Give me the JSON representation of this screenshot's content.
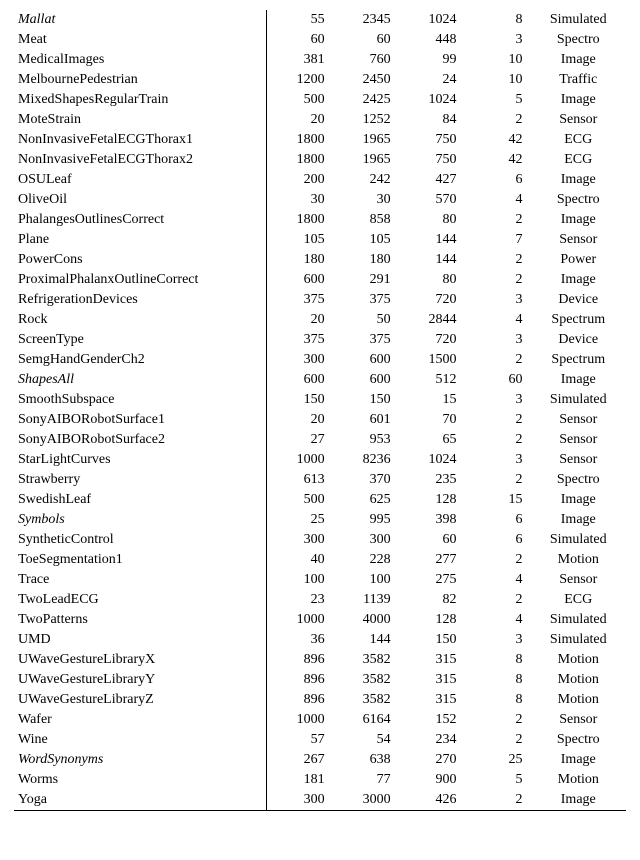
{
  "rows": [
    {
      "name": "Mallat",
      "italic": true,
      "c1": 55,
      "c2": 2345,
      "c3": 1024,
      "c4": 8,
      "cat": "Simulated"
    },
    {
      "name": "Meat",
      "italic": false,
      "c1": 60,
      "c2": 60,
      "c3": 448,
      "c4": 3,
      "cat": "Spectro"
    },
    {
      "name": "MedicalImages",
      "italic": false,
      "c1": 381,
      "c2": 760,
      "c3": 99,
      "c4": 10,
      "cat": "Image"
    },
    {
      "name": "MelbournePedestrian",
      "italic": false,
      "c1": 1200,
      "c2": 2450,
      "c3": 24,
      "c4": 10,
      "cat": "Traffic"
    },
    {
      "name": "MixedShapesRegularTrain",
      "italic": false,
      "c1": 500,
      "c2": 2425,
      "c3": 1024,
      "c4": 5,
      "cat": "Image"
    },
    {
      "name": "MoteStrain",
      "italic": false,
      "c1": 20,
      "c2": 1252,
      "c3": 84,
      "c4": 2,
      "cat": "Sensor"
    },
    {
      "name": "NonInvasiveFetalECGThorax1",
      "italic": false,
      "c1": 1800,
      "c2": 1965,
      "c3": 750,
      "c4": 42,
      "cat": "ECG"
    },
    {
      "name": "NonInvasiveFetalECGThorax2",
      "italic": false,
      "c1": 1800,
      "c2": 1965,
      "c3": 750,
      "c4": 42,
      "cat": "ECG"
    },
    {
      "name": "OSULeaf",
      "italic": false,
      "c1": 200,
      "c2": 242,
      "c3": 427,
      "c4": 6,
      "cat": "Image"
    },
    {
      "name": "OliveOil",
      "italic": false,
      "c1": 30,
      "c2": 30,
      "c3": 570,
      "c4": 4,
      "cat": "Spectro"
    },
    {
      "name": "PhalangesOutlinesCorrect",
      "italic": false,
      "c1": 1800,
      "c2": 858,
      "c3": 80,
      "c4": 2,
      "cat": "Image"
    },
    {
      "name": "Plane",
      "italic": false,
      "c1": 105,
      "c2": 105,
      "c3": 144,
      "c4": 7,
      "cat": "Sensor"
    },
    {
      "name": "PowerCons",
      "italic": false,
      "c1": 180,
      "c2": 180,
      "c3": 144,
      "c4": 2,
      "cat": "Power"
    },
    {
      "name": "ProximalPhalanxOutlineCorrect",
      "italic": false,
      "c1": 600,
      "c2": 291,
      "c3": 80,
      "c4": 2,
      "cat": "Image"
    },
    {
      "name": "RefrigerationDevices",
      "italic": false,
      "c1": 375,
      "c2": 375,
      "c3": 720,
      "c4": 3,
      "cat": "Device"
    },
    {
      "name": "Rock",
      "italic": false,
      "c1": 20,
      "c2": 50,
      "c3": 2844,
      "c4": 4,
      "cat": "Spectrum"
    },
    {
      "name": "ScreenType",
      "italic": false,
      "c1": 375,
      "c2": 375,
      "c3": 720,
      "c4": 3,
      "cat": "Device"
    },
    {
      "name": "SemgHandGenderCh2",
      "italic": false,
      "c1": 300,
      "c2": 600,
      "c3": 1500,
      "c4": 2,
      "cat": "Spectrum"
    },
    {
      "name": "ShapesAll",
      "italic": true,
      "c1": 600,
      "c2": 600,
      "c3": 512,
      "c4": 60,
      "cat": "Image"
    },
    {
      "name": "SmoothSubspace",
      "italic": false,
      "c1": 150,
      "c2": 150,
      "c3": 15,
      "c4": 3,
      "cat": "Simulated"
    },
    {
      "name": "SonyAIBORobotSurface1",
      "italic": false,
      "c1": 20,
      "c2": 601,
      "c3": 70,
      "c4": 2,
      "cat": "Sensor"
    },
    {
      "name": "SonyAIBORobotSurface2",
      "italic": false,
      "c1": 27,
      "c2": 953,
      "c3": 65,
      "c4": 2,
      "cat": "Sensor"
    },
    {
      "name": "StarLightCurves",
      "italic": false,
      "c1": 1000,
      "c2": 8236,
      "c3": 1024,
      "c4": 3,
      "cat": "Sensor"
    },
    {
      "name": "Strawberry",
      "italic": false,
      "c1": 613,
      "c2": 370,
      "c3": 235,
      "c4": 2,
      "cat": "Spectro"
    },
    {
      "name": "SwedishLeaf",
      "italic": false,
      "c1": 500,
      "c2": 625,
      "c3": 128,
      "c4": 15,
      "cat": "Image"
    },
    {
      "name": "Symbols",
      "italic": true,
      "c1": 25,
      "c2": 995,
      "c3": 398,
      "c4": 6,
      "cat": "Image"
    },
    {
      "name": "SyntheticControl",
      "italic": false,
      "c1": 300,
      "c2": 300,
      "c3": 60,
      "c4": 6,
      "cat": "Simulated"
    },
    {
      "name": "ToeSegmentation1",
      "italic": false,
      "c1": 40,
      "c2": 228,
      "c3": 277,
      "c4": 2,
      "cat": "Motion"
    },
    {
      "name": "Trace",
      "italic": false,
      "c1": 100,
      "c2": 100,
      "c3": 275,
      "c4": 4,
      "cat": "Sensor"
    },
    {
      "name": "TwoLeadECG",
      "italic": false,
      "c1": 23,
      "c2": 1139,
      "c3": 82,
      "c4": 2,
      "cat": "ECG"
    },
    {
      "name": "TwoPatterns",
      "italic": false,
      "c1": 1000,
      "c2": 4000,
      "c3": 128,
      "c4": 4,
      "cat": "Simulated"
    },
    {
      "name": "UMD",
      "italic": false,
      "c1": 36,
      "c2": 144,
      "c3": 150,
      "c4": 3,
      "cat": "Simulated"
    },
    {
      "name": "UWaveGestureLibraryX",
      "italic": false,
      "c1": 896,
      "c2": 3582,
      "c3": 315,
      "c4": 8,
      "cat": "Motion"
    },
    {
      "name": "UWaveGestureLibraryY",
      "italic": false,
      "c1": 896,
      "c2": 3582,
      "c3": 315,
      "c4": 8,
      "cat": "Motion"
    },
    {
      "name": "UWaveGestureLibraryZ",
      "italic": false,
      "c1": 896,
      "c2": 3582,
      "c3": 315,
      "c4": 8,
      "cat": "Motion"
    },
    {
      "name": "Wafer",
      "italic": false,
      "c1": 1000,
      "c2": 6164,
      "c3": 152,
      "c4": 2,
      "cat": "Sensor"
    },
    {
      "name": "Wine",
      "italic": false,
      "c1": 57,
      "c2": 54,
      "c3": 234,
      "c4": 2,
      "cat": "Spectro"
    },
    {
      "name": "WordSynonyms",
      "italic": true,
      "c1": 267,
      "c2": 638,
      "c3": 270,
      "c4": 25,
      "cat": "Image"
    },
    {
      "name": "Worms",
      "italic": false,
      "c1": 181,
      "c2": 77,
      "c3": 900,
      "c4": 5,
      "cat": "Motion"
    },
    {
      "name": "Yoga",
      "italic": false,
      "c1": 300,
      "c2": 3000,
      "c3": 426,
      "c4": 2,
      "cat": "Image"
    }
  ]
}
